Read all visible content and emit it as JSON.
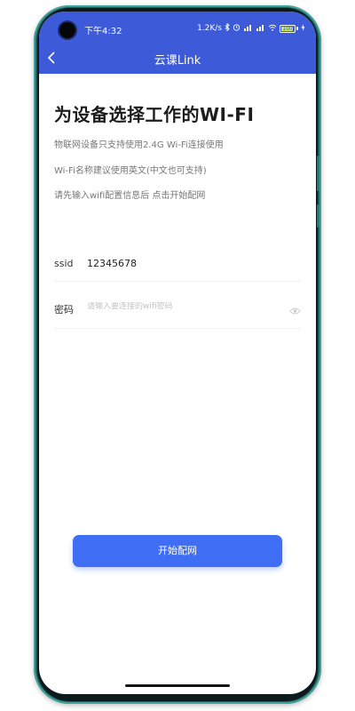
{
  "status_bar": {
    "time": "下午4:32",
    "net_speed": "1.2K/s",
    "battery_level": "100",
    "icons": [
      "bluetooth-icon",
      "alarm-icon",
      "signal-icon",
      "wifi-icon",
      "battery-icon",
      "charging-icon"
    ]
  },
  "header": {
    "title": "云课Link",
    "back_icon": "chevron-left-icon",
    "background_color": "#3d5bd9"
  },
  "main": {
    "heading": "为设备选择工作的WI-FI",
    "descriptions": [
      "物联网设备只支持使用2.4G Wi-Fi连接使用",
      "Wi-Fi名称建议使用英文(中文也可支持)",
      "请先输入wifi配置信息后 点击开始配网"
    ]
  },
  "form": {
    "ssid_label": "ssid",
    "ssid_value": "12345678",
    "password_label": "密码",
    "password_placeholder": "请输入要连接的wifi密码",
    "password_toggle_icon": "eye-icon"
  },
  "action": {
    "start_label": "开始配网",
    "button_color": "#3f6ef5"
  }
}
